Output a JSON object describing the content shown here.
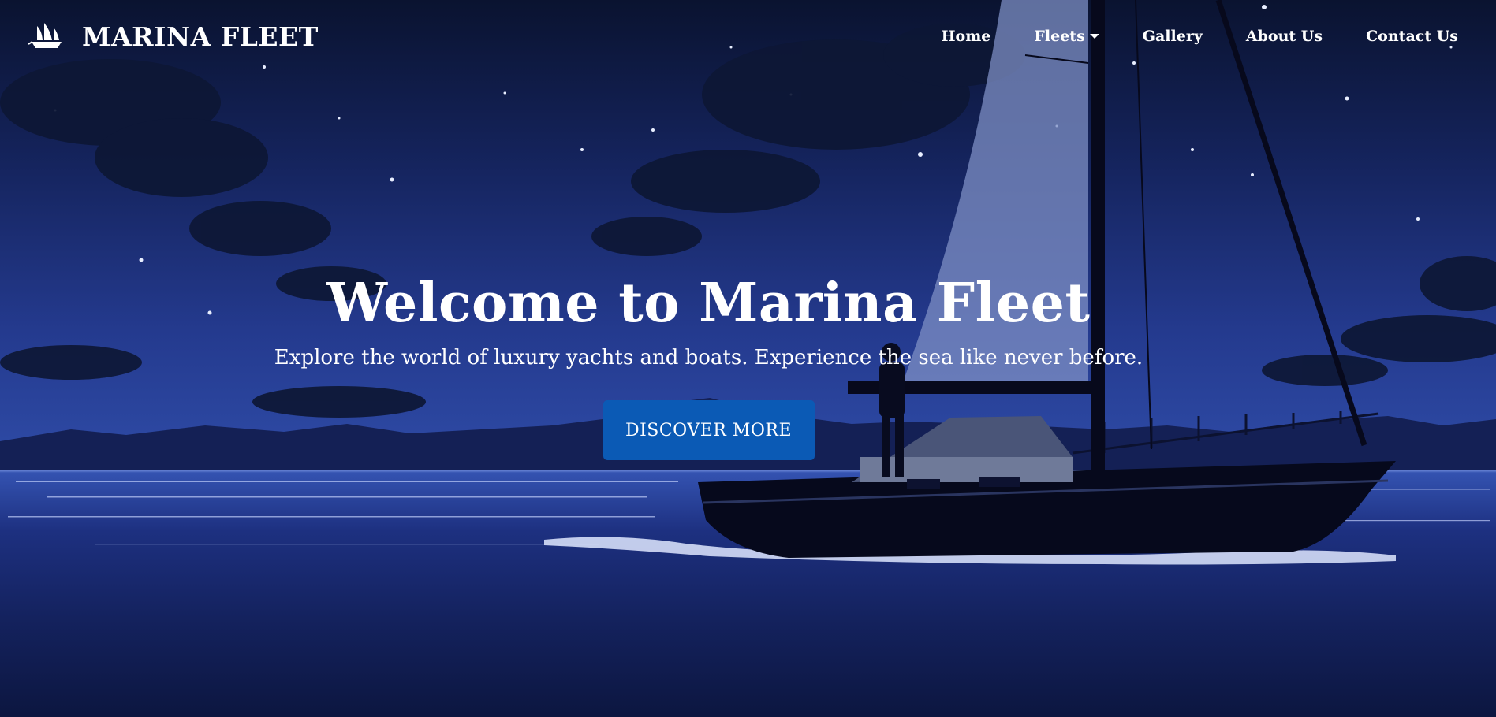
{
  "brand": {
    "name": "MARINA FLEET",
    "icon": "sailing-ship-icon"
  },
  "nav": {
    "items": [
      {
        "label": "Home"
      },
      {
        "label": "Fleets",
        "dropdown": true
      },
      {
        "label": "Gallery"
      },
      {
        "label": "About Us"
      },
      {
        "label": "Contact Us"
      }
    ]
  },
  "hero": {
    "title": "Welcome to Marina Fleet",
    "subtitle": "Explore the world of luxury yachts and boats. Experience the sea like never before.",
    "cta_label": "DISCOVER MORE"
  },
  "colors": {
    "cta": "#0b5ab5",
    "sky_top": "#0a1330",
    "sea": "#14225e",
    "text": "#ffffff"
  }
}
